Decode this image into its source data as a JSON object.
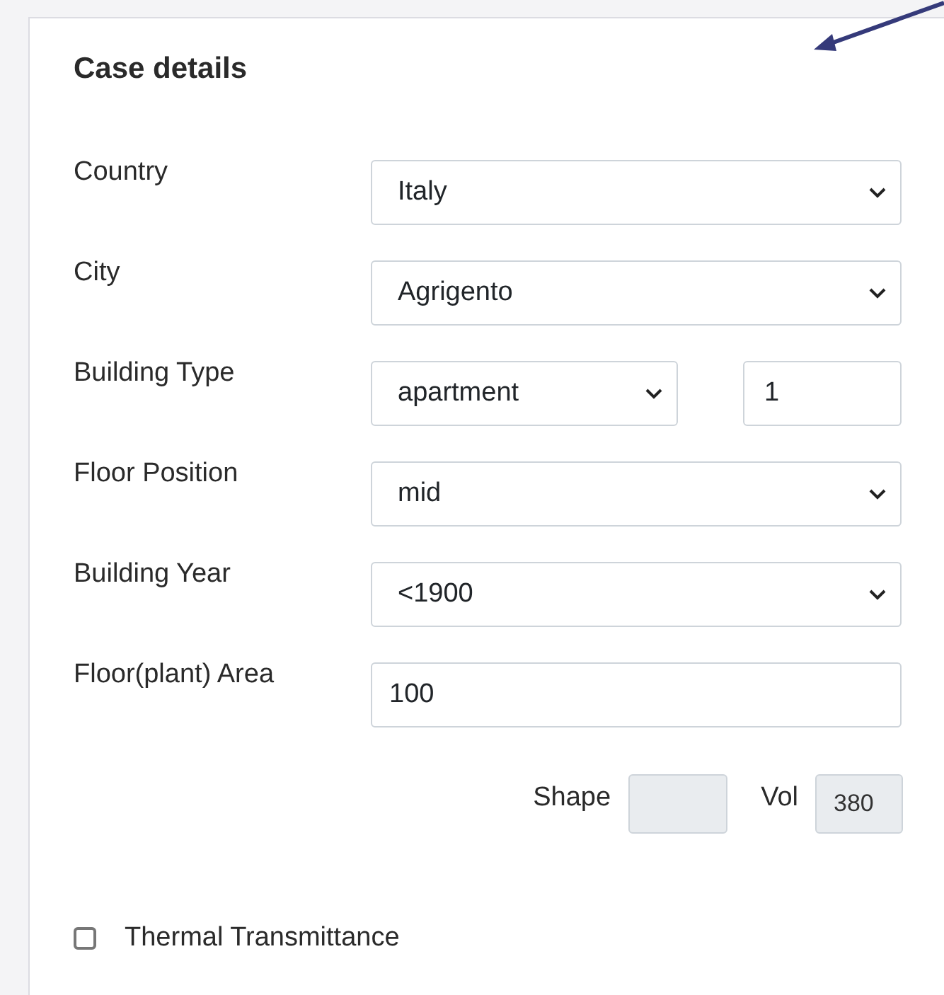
{
  "card": {
    "title": "Case details"
  },
  "fields": [
    {
      "kind": "select",
      "label": "Country",
      "value": "Italy"
    },
    {
      "kind": "select",
      "label": "City",
      "value": "Agrigento"
    },
    {
      "kind": "select_number",
      "label": "Building Type",
      "value": "apartment",
      "number": "1"
    },
    {
      "kind": "select",
      "label": "Floor Position",
      "value": "mid"
    },
    {
      "kind": "select",
      "label": "Building Year",
      "value": "<1900"
    },
    {
      "kind": "input",
      "label": "Floor(plant) Area",
      "value": "100"
    }
  ],
  "readouts": [
    {
      "label": "Shape"
    },
    {
      "label": "Vol",
      "value": "380"
    }
  ],
  "checkbox": {
    "label": "Thermal Transmittance",
    "checked": false
  }
}
